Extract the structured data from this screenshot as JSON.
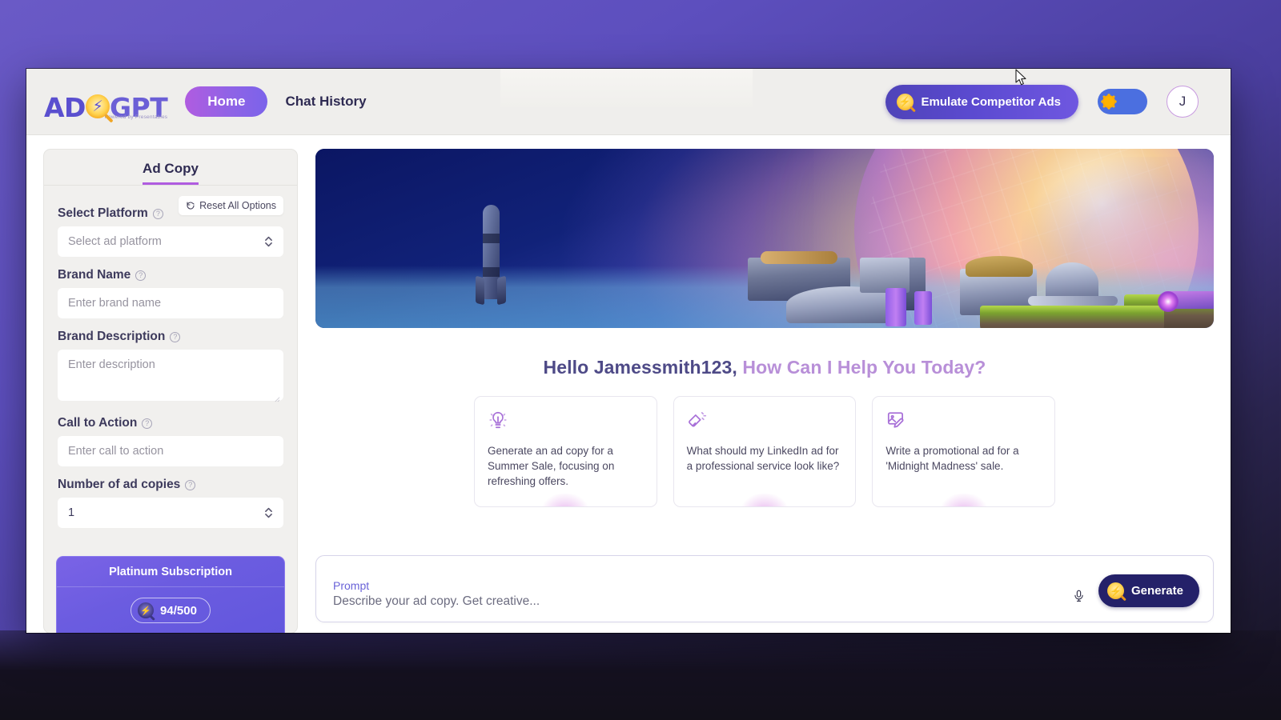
{
  "header": {
    "logo": {
      "ad": "AD",
      "gpt": "GPT",
      "tagline": "Powered by Presentables",
      "mark_icon": "lightning-magnifier-icon"
    },
    "nav": [
      {
        "label": "Home",
        "active": true
      },
      {
        "label": "Chat History",
        "active": false
      }
    ],
    "emulate_button": {
      "label": "Emulate Competitor Ads",
      "icon": "lightning-magnifier-icon"
    },
    "theme_toggle": {
      "state": "light",
      "icon": "sun-icon"
    },
    "avatar": {
      "initial": "J"
    }
  },
  "sidebar": {
    "tab": {
      "label": "Ad Copy",
      "active": true
    },
    "reset_button": {
      "label": "Reset All Options",
      "icon": "reset-icon"
    },
    "fields": [
      {
        "label": "Select Platform",
        "type": "select",
        "placeholder": "Select ad platform",
        "value": "",
        "help_icon": "question-icon"
      },
      {
        "label": "Brand Name",
        "type": "text",
        "placeholder": "Enter brand name",
        "value": "",
        "help_icon": "question-icon"
      },
      {
        "label": "Brand Description",
        "type": "textarea",
        "placeholder": "Enter description",
        "value": "",
        "help_icon": "question-icon"
      },
      {
        "label": "Call to Action",
        "type": "text",
        "placeholder": "Enter call to action",
        "value": "",
        "help_icon": "question-icon"
      },
      {
        "label": "Number of ad copies",
        "type": "number",
        "placeholder": "",
        "value": "1",
        "help_icon": "question-icon"
      }
    ],
    "subscription": {
      "title": "Platinum Subscription",
      "credits": "94/500",
      "credits_icon": "coin-icon"
    }
  },
  "main": {
    "hero": {
      "alt": "futuristic sci-fi city with rocket and glowing planet"
    },
    "greeting": {
      "primary": "Hello Jamessmith123,",
      "secondary": "How Can I Help You Today?"
    },
    "suggestions": [
      {
        "icon": "lightbulb-icon",
        "text": "Generate an ad copy for a Summer Sale, focusing on refreshing offers."
      },
      {
        "icon": "megaphone-icon",
        "text": "What should my LinkedIn ad for a professional service look like?"
      },
      {
        "icon": "image-edit-icon",
        "text": "Write a promotional ad for a 'Midnight Madness' sale."
      }
    ],
    "prompt": {
      "label": "Prompt",
      "placeholder": "Describe your ad copy. Get creative...",
      "value": "",
      "mic_icon": "microphone-icon",
      "generate_label": "Generate",
      "generate_icon": "lightning-magnifier-icon"
    }
  },
  "colors": {
    "accent_purple": "#b05ce0",
    "accent_indigo": "#5b4ad0",
    "generate_navy": "#242169",
    "toggle_blue": "#4b6fe0",
    "desktop_bg": "#5d4fbe"
  }
}
